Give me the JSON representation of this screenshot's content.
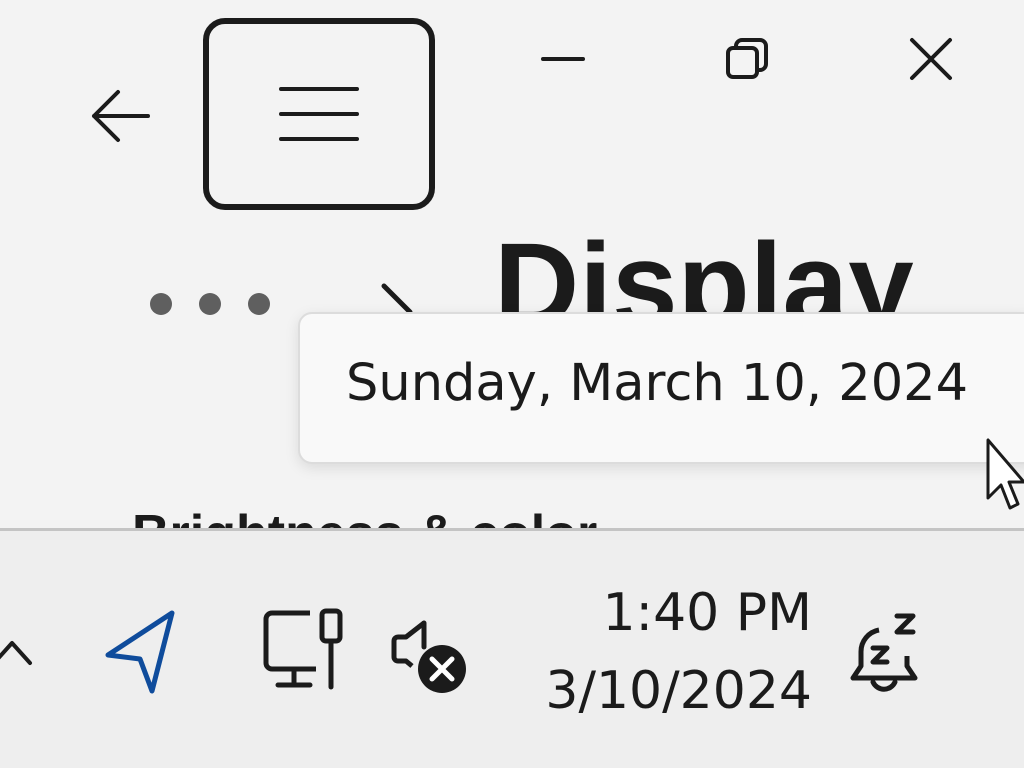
{
  "window": {
    "page_title": "Display",
    "section_heading": "Brightness & color",
    "breadcrumb_overflow": "...",
    "icons": {
      "back": "back-arrow-icon",
      "nav": "hamburger-menu-icon",
      "minimize": "minimize-icon",
      "maximize": "restore-icon",
      "close": "close-icon",
      "chevron": "chevron-right-icon"
    }
  },
  "tooltip": {
    "text": "Sunday, March 10, 2024"
  },
  "taskbar": {
    "time": "1:40 PM",
    "date": "3/10/2024",
    "icons": {
      "overflow": "chevron-up-icon",
      "location": "location-icon",
      "network": "ethernet-network-icon",
      "volume": "volume-muted-icon",
      "notifications": "notifications-snooze-icon"
    },
    "accent_color": "#0f4c9c"
  }
}
